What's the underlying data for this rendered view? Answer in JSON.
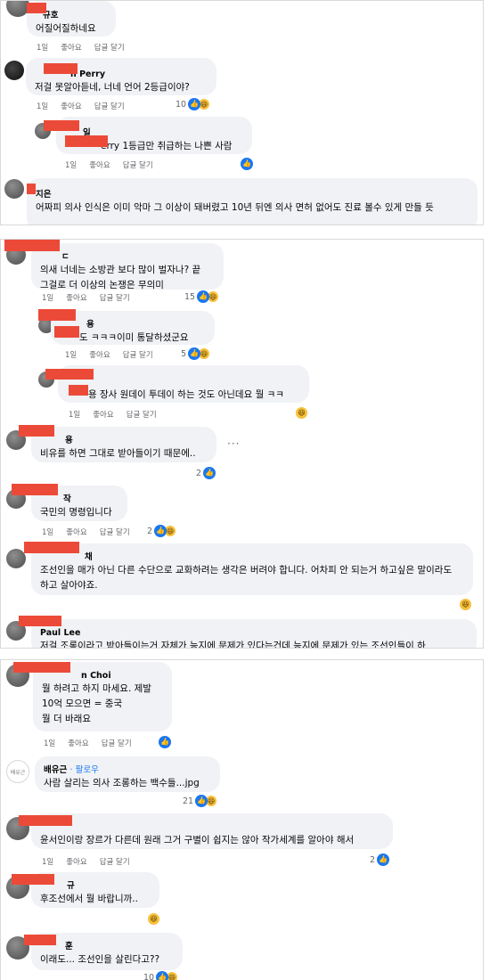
{
  "actions": {
    "time": "1일",
    "like": "좋아요",
    "reply": "답글 달기"
  },
  "icons": {
    "like": "thumbs-up-icon",
    "haha": "haha-icon",
    "more": "more-icon"
  },
  "colors": {
    "bubble": "#f0f2f5",
    "like": "#1877f2",
    "redaction": "#ec4a38",
    "meta": "#65676b"
  },
  "panel1": {
    "c1": {
      "name": "규호",
      "text": "어질어질하네요"
    },
    "c2": {
      "name": "n Perry",
      "text": "저걸 못알아듣네, 너네 언어 2등급이야?",
      "count": "10"
    },
    "c3": {
      "name": "일",
      "text": "erry 1등급만 취급하는 나쁜 사람"
    },
    "c4": {
      "name": "지은",
      "text": "어짜피 의사 인식은 이미 악마 그 이상이 돼버렸고 10년 뒤엔 의사 면허 없어도 진료 볼수 있게 만들 듯"
    }
  },
  "panel2": {
    "c1": {
      "name": "ㄷ",
      "text": "의새 너네는 소방관 보다 많이 벌자나? 끝\n그걸로 더 이상의 논쟁은 무의미",
      "count": "15"
    },
    "c2": {
      "name": "용",
      "text": "도 ㅋㅋㅋ이미 통달하셨군요",
      "count": "5"
    },
    "c3": {
      "name": "",
      "text": "용 장사 원데이 투데이 하는 것도 아닌데요 뭘 ㅋㅋ"
    },
    "c4": {
      "name": "용",
      "text": "비유를 하면 그대로 받아들이기 때문에..",
      "count": "2",
      "more": "···"
    },
    "c5": {
      "name": "작",
      "text": "국민의 명령입니다",
      "count": "2"
    },
    "c6": {
      "name": "채",
      "text": "조선인을 매가 아닌 다른 수단으로 교화하려는 생각은 버려야 합니다. 어차피 안 되는거 하고싶은 말이라도 하고 살아야죠."
    },
    "c7": {
      "name": "Paul Lee",
      "text": "저걸 조롱이라고 받아들이는거 자체가 능지에 문제가 있다는건데 능지에 문제가 있는 조선인들이 하"
    }
  },
  "panel3": {
    "c1": {
      "name": "n Choi",
      "text": "뭘 하려고 하지 마세요. 제발\n10억 모으면 = 중국\n뭘 더 바래요"
    },
    "c2": {
      "name": "배유근",
      "follow": "· 팔로우",
      "avatar_text": "배유근",
      "text": "사람 살리는 의사 조롱하는 백수들...jpg",
      "count": "21"
    },
    "c3": {
      "name": "",
      "text": "윤서인이랑 장르가 다른데 원래 그거 구별이 쉽지는 않아 작가세계를 알아야 해서",
      "count": "2"
    },
    "c4": {
      "name": "규",
      "text": "후조선에서 뭘 바랍니까.."
    },
    "c5": {
      "name": "훈",
      "text": "이래도... 조선인을 살린다고??",
      "count": "10"
    }
  }
}
